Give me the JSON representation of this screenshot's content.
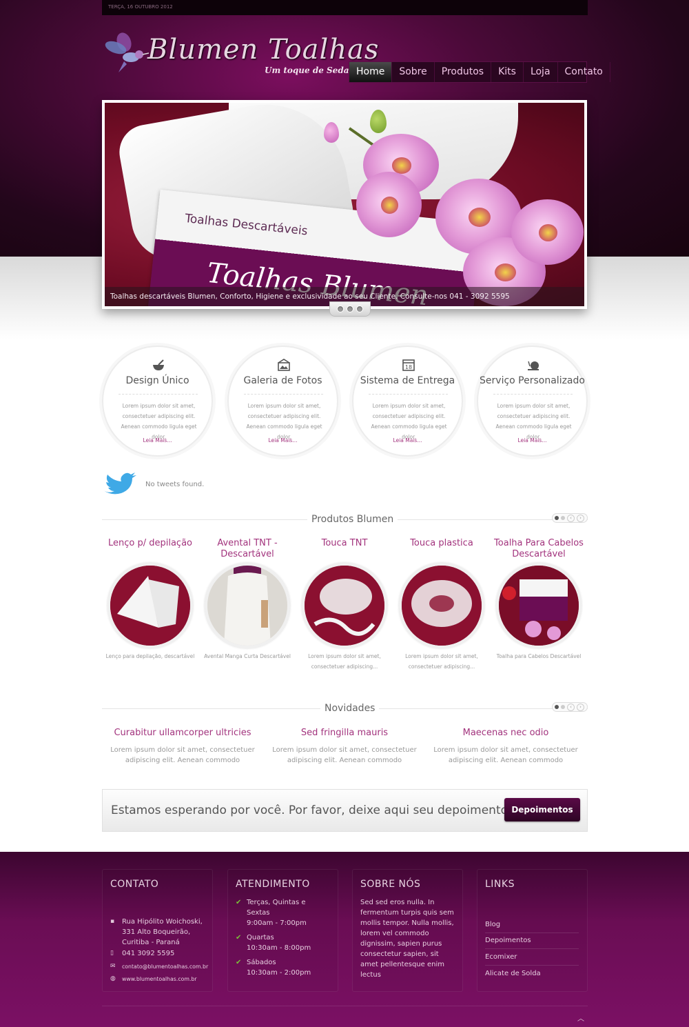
{
  "header": {
    "date": "TERÇA, 16 OUTUBRO 2012",
    "logo_title": "Blumen Toalhas",
    "logo_tagline": "Um toque de Seda",
    "nav": [
      "Home",
      "Sobre",
      "Produtos",
      "Kits",
      "Loja",
      "Contato"
    ]
  },
  "slider": {
    "package_text": "Toalhas Descartáveis",
    "package_brand": "Toalhas Blumen",
    "caption": "Toalhas descartáveis Blumen, Conforto, Higiene e exclusividade ao seu Cliente. Consulte-nos 041 - 3092 5595"
  },
  "features": [
    {
      "title": "Design Único",
      "icon": "mortar-icon",
      "text": "Lorem ipsum dolor sit amet, consectetuer adipiscing elit. Aenean commodo ligula eget dolor.",
      "more": "Leia Mais..."
    },
    {
      "title": "Galeria de Fotos",
      "icon": "photo-icon",
      "text": "Lorem ipsum dolor sit amet, consectetuer adipiscing elit. Aenean commodo ligula eget dolor.",
      "more": "Leia Mais..."
    },
    {
      "title": "Sistema de Entrega",
      "icon": "calendar-icon",
      "text": "Lorem ipsum dolor sit amet, consectetuer adipiscing elit. Aenean commodo ligula eget dolor.",
      "more": "Leia Mais..."
    },
    {
      "title": "Serviço Personalizado",
      "icon": "snail-icon",
      "text": "Lorem ipsum dolor sit amet, consectetuer adipiscing elit. Aenean commodo ligula eget dolor.",
      "more": "Leia Mais..."
    }
  ],
  "twitter": {
    "text": "No tweets found."
  },
  "products": {
    "title": "Produtos Blumen",
    "items": [
      {
        "title": "Lenço p/ depilação",
        "desc": "Lenço para depilação, descartável"
      },
      {
        "title": "Avental TNT - Descartável",
        "desc": "Avental Manga Curta Descartável"
      },
      {
        "title": "Touca TNT",
        "desc": "Lorem ipsum dolor sit amet, consectetuer adipiscing..."
      },
      {
        "title": "Touca plastica",
        "desc": "Lorem ipsum dolor sit amet, consectetuer adipiscing..."
      },
      {
        "title": "Toalha Para Cabelos Descartável",
        "desc": "Toalha para Cabelos Descartável"
      }
    ]
  },
  "news": {
    "title": "Novidades",
    "items": [
      {
        "title": "Curabitur ullamcorper ultricies",
        "text": "Lorem ipsum dolor sit amet, consectetuer adipiscing elit. Aenean commodo"
      },
      {
        "title": "Sed fringilla mauris",
        "text": "Lorem ipsum dolor sit amet, consectetuer adipiscing elit. Aenean commodo"
      },
      {
        "title": "Maecenas nec odio",
        "text": "Lorem ipsum dolor sit amet, consectetuer adipiscing elit. Aenean commodo"
      }
    ]
  },
  "cta": {
    "text": "Estamos esperando por você. Por favor, deixe aqui seu depoimento!",
    "button": "Depoimentos"
  },
  "footer": {
    "contato": {
      "title": "CONTATO",
      "address": "Rua Hipólito Woichoski, 331 Alto Boqueirão, Curitiba - Paraná",
      "phone": "041 3092 5595",
      "email": "contato@blumentoalhas.com.br",
      "site": "www.blumentoalhas.com.br"
    },
    "atendimento": {
      "title": "ATENDIMENTO",
      "items": [
        {
          "days": "Terças, Quintas e Sextas",
          "hours": "9:00am - 7:00pm"
        },
        {
          "days": "Quartas",
          "hours": "10:30am - 8:00pm"
        },
        {
          "days": "Sábados",
          "hours": "10:30am - 2:00pm"
        }
      ]
    },
    "sobre": {
      "title": "SOBRE NÓS",
      "text": "Sed sed eros nulla. In fermentum turpis quis sem mollis tempor. Nulla mollis, lorem vel commodo dignissim, sapien purus consectetur sapien, sit amet pellentesque enim lectus"
    },
    "links": {
      "title": "LINKS",
      "items": [
        "Blog",
        "Depoimentos",
        "Ecomixer",
        "Alicate de Solda"
      ]
    }
  },
  "colors": {
    "brand": "#7b1064",
    "accent": "#a2337d",
    "dark": "#23061b"
  }
}
